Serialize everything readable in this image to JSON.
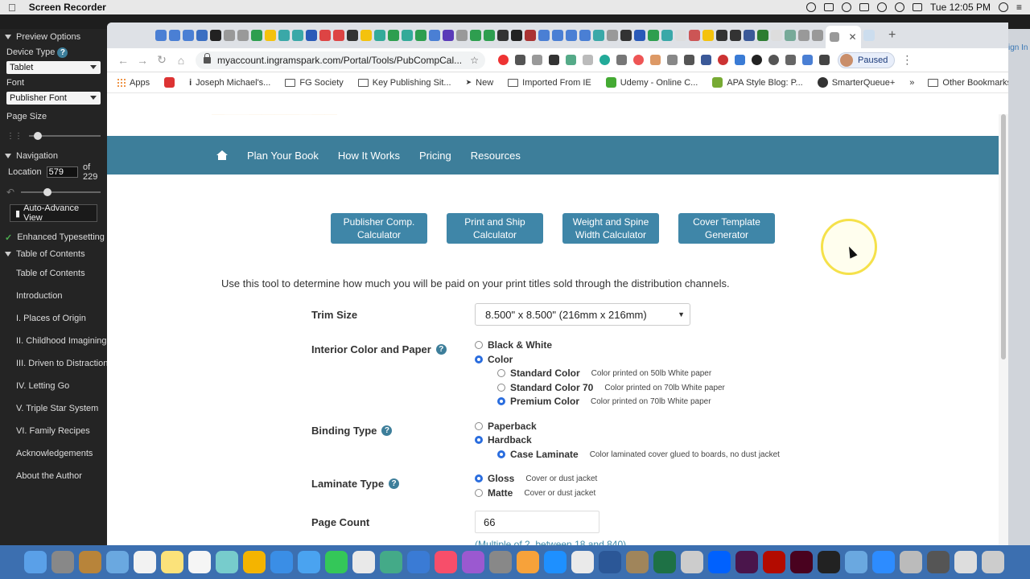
{
  "menubar": {
    "app_name": "Screen Recorder",
    "clock": "Tue 12:05 PM"
  },
  "sidebar": {
    "preview_options": "Preview Options",
    "device_type_label": "Device Type",
    "device_type_value": "Tablet",
    "font_label": "Font",
    "font_value": "Publisher Font",
    "page_size_label": "Page Size",
    "navigation": "Navigation",
    "location_label": "Location",
    "location_value": "579",
    "location_total": "of 229",
    "auto_advance": "Auto-Advance View",
    "enhanced_typesetting": "Enhanced Typesetting",
    "toc_header": "Table of Contents",
    "toc_items": [
      "Table of Contents",
      "Introduction",
      "I. Places of Origin",
      "II. Childhood Imaginings",
      "III. Driven to Distraction",
      "IV. Letting Go",
      "V. Triple Star System",
      "VI. Family Recipes",
      "Acknowledgements",
      "About the Author"
    ]
  },
  "browser": {
    "url": "myaccount.ingramspark.com/Portal/Tools/PubCompCal...",
    "profile": "Paused",
    "bookmarks": [
      "Apps",
      "Joseph Michael's...",
      "FG Society",
      "Key Publishing Sit...",
      "New",
      "Imported From IE",
      "Udemy - Online C...",
      "APA Style Blog: P...",
      "SmarterQueue+"
    ],
    "other_bookmarks": "Other Bookmarks"
  },
  "nav": {
    "links": [
      "Plan Your Book",
      "How It Works",
      "Pricing",
      "Resources"
    ]
  },
  "calculators": [
    "Publisher Comp. Calculator",
    "Print and Ship Calculator",
    "Weight and Spine Width Calculator",
    "Cover Template Generator"
  ],
  "intro": "Use this tool to determine how much you will be paid on your print titles sold through the distribution channels.",
  "form": {
    "trim_label": "Trim Size",
    "trim_value": "8.500\" x 8.500\" (216mm x 216mm)",
    "interior_label": "Interior Color and Paper",
    "interior_options": [
      {
        "name": "Black & White",
        "desc": ""
      },
      {
        "name": "Color",
        "desc": ""
      }
    ],
    "color_options": [
      {
        "name": "Standard Color",
        "desc": "Color printed on 50lb White paper"
      },
      {
        "name": "Standard Color 70",
        "desc": "Color printed on 70lb White paper"
      },
      {
        "name": "Premium Color",
        "desc": "Color printed on 70lb White paper"
      }
    ],
    "binding_label": "Binding Type",
    "binding_options": [
      {
        "name": "Paperback",
        "desc": ""
      },
      {
        "name": "Hardback",
        "desc": ""
      }
    ],
    "case_laminate": {
      "name": "Case Laminate",
      "desc": "Color laminated cover glued to boards, no dust jacket"
    },
    "laminate_label": "Laminate Type",
    "laminate_options": [
      {
        "name": "Gloss",
        "desc": "Cover or dust jacket"
      },
      {
        "name": "Matte",
        "desc": "Cover or dust jacket"
      }
    ],
    "page_count_label": "Page Count",
    "page_count_value": "66",
    "page_count_hint": "(Multiple of 2, between 18 and 840)"
  },
  "right_strip": {
    "signin": "ign In"
  }
}
